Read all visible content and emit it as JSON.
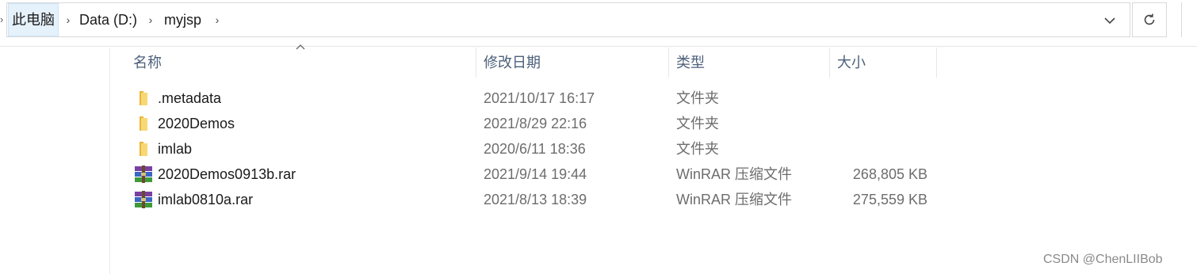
{
  "breadcrumb": {
    "items": [
      {
        "label": "此电脑"
      },
      {
        "label": "Data (D:)"
      },
      {
        "label": "myjsp"
      }
    ]
  },
  "columns": {
    "name": "名称",
    "date": "修改日期",
    "type": "类型",
    "size": "大小"
  },
  "files": [
    {
      "name": ".metadata",
      "date": "2021/10/17 16:17",
      "type": "文件夹",
      "size": "",
      "icon": "folder-icon"
    },
    {
      "name": "2020Demos",
      "date": "2021/8/29 22:16",
      "type": "文件夹",
      "size": "",
      "icon": "folder-icon"
    },
    {
      "name": "imlab",
      "date": "2020/6/11 18:36",
      "type": "文件夹",
      "size": "",
      "icon": "folder-icon"
    },
    {
      "name": "2020Demos0913b.rar",
      "date": "2021/9/14 19:44",
      "type": "WinRAR 压缩文件",
      "size": "268,805 KB",
      "icon": "winrar-archive-icon"
    },
    {
      "name": "imlab0810a.rar",
      "date": "2021/8/13 18:39",
      "type": "WinRAR 压缩文件",
      "size": "275,559 KB",
      "icon": "winrar-archive-icon"
    }
  ],
  "watermark": "CSDN @ChenLIIBob",
  "colors": {
    "header_text": "#4c607a",
    "secondary_text": "#6d6d6d",
    "crumb_highlight": "#e5f1fb",
    "folder": "#f8d775"
  }
}
